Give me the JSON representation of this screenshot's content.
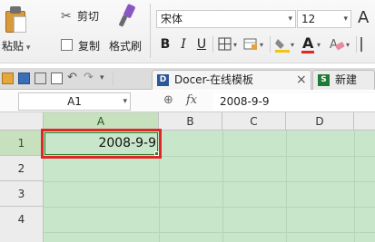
{
  "ribbon": {
    "paste_label": "粘贴",
    "cut_label": "剪切",
    "copy_label": "复制",
    "format_painter_label": "格式刷",
    "font_name": "宋体",
    "font_size": "12",
    "bold": "B",
    "italic": "I",
    "underline": "U",
    "font_color_label": "A",
    "large_a": "A"
  },
  "tabs": {
    "docer_label": "Docer-在线模板",
    "new_label": "新建",
    "close_glyph": "×"
  },
  "formula_bar": {
    "name_box": "A1",
    "fx_label": "fx",
    "content": "2008-9-9"
  },
  "grid": {
    "columns": [
      "A",
      "B",
      "C",
      "D"
    ],
    "rows": [
      "1",
      "2",
      "3",
      "4"
    ],
    "a1_value": "2008-9-9"
  },
  "colors": {
    "sheet_bg": "#c8e6c9",
    "highlight_border": "#e02626",
    "selected_header": "#c7e0bd"
  }
}
